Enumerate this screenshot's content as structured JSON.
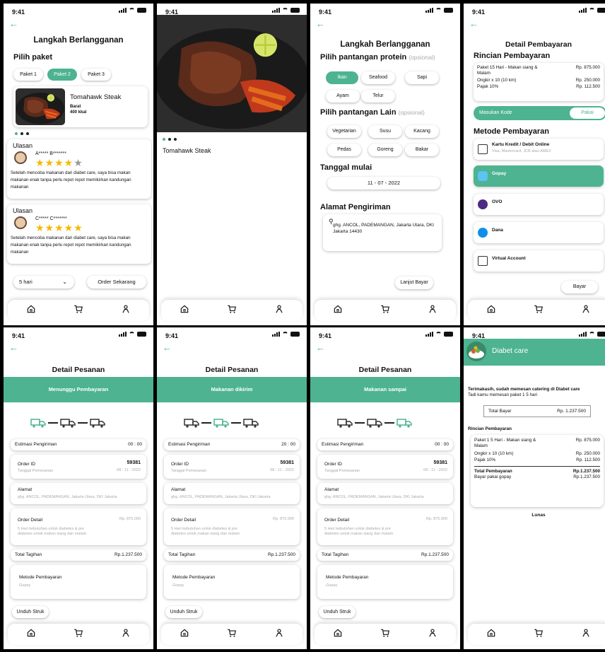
{
  "status": {
    "time": "9:41"
  },
  "colors": {
    "accent": "#4db391",
    "star": "#f5b800"
  },
  "s1": {
    "title": "Langkah Berlangganan",
    "pick": "Pilih paket",
    "pakets": [
      "Paket 1",
      "Paket 2",
      "Paket 3"
    ],
    "product": {
      "name": "Tomahawk Steak",
      "sub1": "Barat",
      "sub2": "400 kkal"
    },
    "reviews": [
      {
        "head": "Ulasan",
        "user": "A***** B*******",
        "stars": 4,
        "text": "Setelah mencoba makanan dari diabet care, saya bisa makan makanan enak tanpa perlu repot repot memikirkan kandungan makanan"
      },
      {
        "head": "Ulasan",
        "user": "C***** C*******",
        "stars": 5,
        "text": "Setelah mencoba makanan dari diabet care, saya bisa makan makanan enak tanpa perlu repot repot memikirkan kandungan makanan"
      }
    ],
    "days": "5 hari",
    "order": "Order Sekarang"
  },
  "s2": {
    "name": "Tomahawk Steak"
  },
  "s3": {
    "title": "Langkah Berlangganan",
    "protein": "Pilih pantangan protein",
    "opt": "(opsional)",
    "proteins": [
      "Ikan",
      "Seafood",
      "Sapi",
      "Ayam",
      "Telur"
    ],
    "lain": "Pilih pantangan Lain",
    "lains": [
      "Vegetarian",
      "Susu",
      "Kacang",
      "Pedas",
      "Goreng",
      "Bakar"
    ],
    "tgl": "Tanggal mulai",
    "date": "11 - 07 - 2022",
    "alamat": "Alamat Pengiriman",
    "addr": "ghg. ANCOL, PADEMANGAN, Jakarta Utara, DKI Jakarta 14430",
    "next": "Lanjut Bayar"
  },
  "s4": {
    "title": "Detail Pembayaran",
    "rincian": "Rincian Pembayaran",
    "items": [
      {
        "k": "Paket 15 Hari - Makan siang & Malam",
        "v": "Rp. 875.000"
      },
      {
        "k": "Ongkir x 10 (10 km)",
        "v": "Rp. 250.000"
      },
      {
        "k": "Pajak 10%",
        "v": "Rp. 112.500"
      }
    ],
    "kode": "Masukan Kode",
    "pakai": "Pakai",
    "metode": "Metode Pembayaran",
    "methods": [
      {
        "name": "Kartu Kredit / Debit Online",
        "sub": "Visa, Mastercard, JCB atau AMEX"
      },
      {
        "name": "Gopay",
        "sub": ""
      },
      {
        "name": "OVO",
        "sub": ""
      },
      {
        "name": "Dana",
        "sub": ""
      },
      {
        "name": "Virtual Account",
        "sub": ""
      }
    ],
    "bayar": "Bayar"
  },
  "orders": [
    {
      "status": "Menunggu Pembayaran",
      "est": "00 : 00"
    },
    {
      "status": "Makanan dikirim",
      "est": "20 : 00"
    },
    {
      "status": "Makanan sampai",
      "est": "00 : 00"
    }
  ],
  "order": {
    "title": "Detail Pesanan",
    "estLabel": "Estimasi Pengiriman",
    "idLabel": "Order ID",
    "id": "59381",
    "tglLabel": "Tanggal Pemesanan",
    "tgl": "08 - 11 - 2022",
    "alamatLabel": "Alamat",
    "alamat": "ghg. ANCOL, PADEMANGAN, Jakarta Utara, DKI Jakarta",
    "detailLabel": "Order Detail",
    "detailPrice": "Rp. 875.000",
    "detailText": "5 Hari kebutuhan untuk diabetes & pre diabetes untuk makan siang dan malam",
    "totalLabel": "Total Tagihan",
    "total": "Rp.1.237.500",
    "metodeLabel": "Metode Pembayaran",
    "metode": "Gopay",
    "struk": "Unduh Struk"
  },
  "s8": {
    "brand": "Diabet care",
    "thanks": "Terimakasih, sudah memesan catering di Diabet care",
    "tadi": "Tadi kamu memesan paket 1 5 hari",
    "totalLabel": "Total Bayar",
    "total": "Rp. 1.237.500",
    "rincian": "Rincian Pembayaran",
    "items": [
      {
        "k": "Paket 1 5 Hari - Makan siang & Malam",
        "v": "Rp. 875.000"
      },
      {
        "k": "Ongkir x 10 (10 km)",
        "v": "Rp. 250.000"
      },
      {
        "k": "Pajak 10%",
        "v": "Rp. 112.500"
      }
    ],
    "tpLabel": "Total Pembayaran",
    "tp": "Rp.1.237.500",
    "viaLabel": "Bayar pakai gopay",
    "via": "Rp.1.237.500",
    "lunas": "Lunas"
  }
}
